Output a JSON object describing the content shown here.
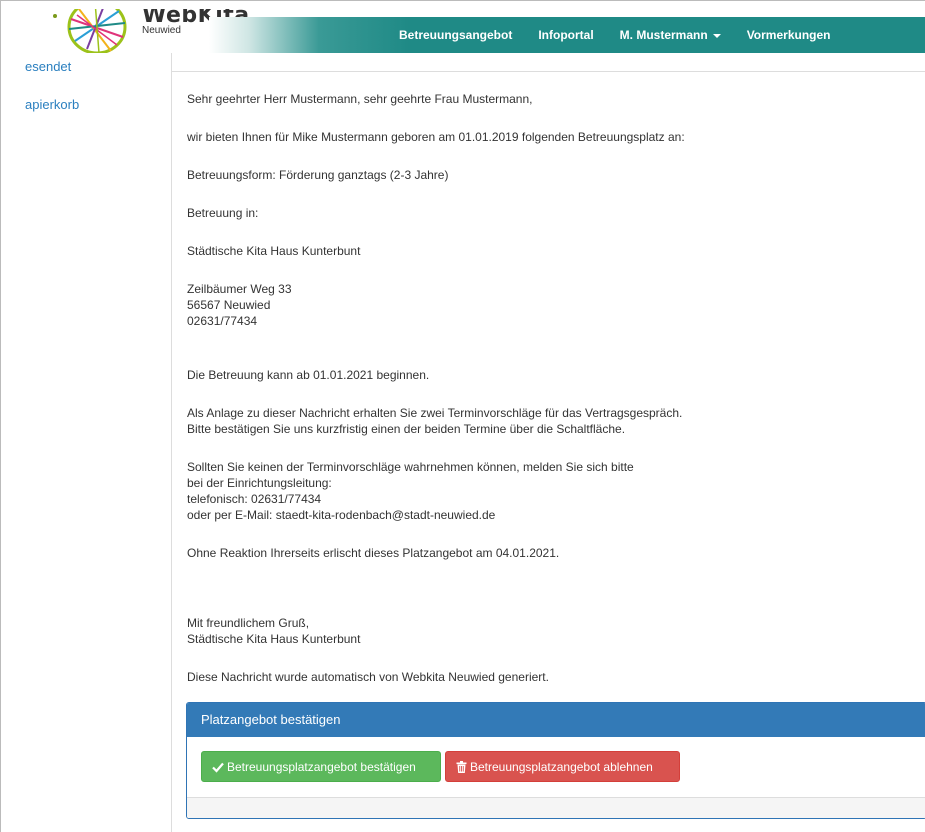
{
  "header": {
    "logo_name": "WebKita",
    "logo_sub": "Neuwied",
    "nav": {
      "betreuungsangebot": "Betreuungsangebot",
      "infoportal": "Infoportal",
      "user": "M. Mustermann",
      "vormerkungen": "Vormerkungen"
    }
  },
  "sidebar": {
    "items": [
      {
        "label": "esendet"
      },
      {
        "label": "apierkorb"
      }
    ]
  },
  "message": {
    "salutation": "Sehr geehrter Herr Mustermann, sehr geehrte Frau Mustermann,",
    "intro": "wir bieten Ihnen für Mike Mustermann geboren am 01.01.2019 folgenden Betreuungsplatz an:",
    "form": "Betreuungsform: Förderung ganztags (2-3 Jahre)",
    "betreuung_in": "Betreuung in:",
    "kita_name": "Städtische Kita Haus Kunterbunt",
    "street": "Zeilbäumer Weg 33",
    "city": "56567 Neuwied",
    "phone": "02631/77434",
    "start": "Die Betreuung kann ab 01.01.2021 beginnen.",
    "anlage_1": "Als Anlage zu dieser Nachricht erhalten Sie zwei Terminvorschläge für das Vertragsgespräch.",
    "anlage_2": "Bitte bestätigen Sie uns kurzfristig einen der beiden Termine über die Schaltfläche.",
    "contact_1": "Sollten Sie keinen der Terminvorschläge wahrnehmen können, melden Sie sich bitte",
    "contact_2": "bei der Einrichtungsleitung:",
    "contact_3": "telefonisch: 02631/77434",
    "contact_4": "oder per E-Mail: staedt-kita-rodenbach@stadt-neuwied.de",
    "expire": "Ohne Reaktion Ihrerseits erlischt dieses Platzangebot am 04.01.2021.",
    "greeting": "Mit freundlichem Gruß,",
    "signature": "Städtische Kita Haus Kunterbunt",
    "auto": "Diese Nachricht wurde automatisch von Webkita Neuwied generiert."
  },
  "panel": {
    "title": "Platzangebot bestätigen",
    "confirm_label": "Betreuungsplatzangebot bestätigen",
    "reject_label": "Betreuungsplatzangebot ablehnen"
  },
  "colors": {
    "nav_teal": "#1f8a86",
    "panel_blue": "#337ab7",
    "success": "#5cb85c",
    "danger": "#d9534f",
    "link": "#2a7fbf"
  }
}
